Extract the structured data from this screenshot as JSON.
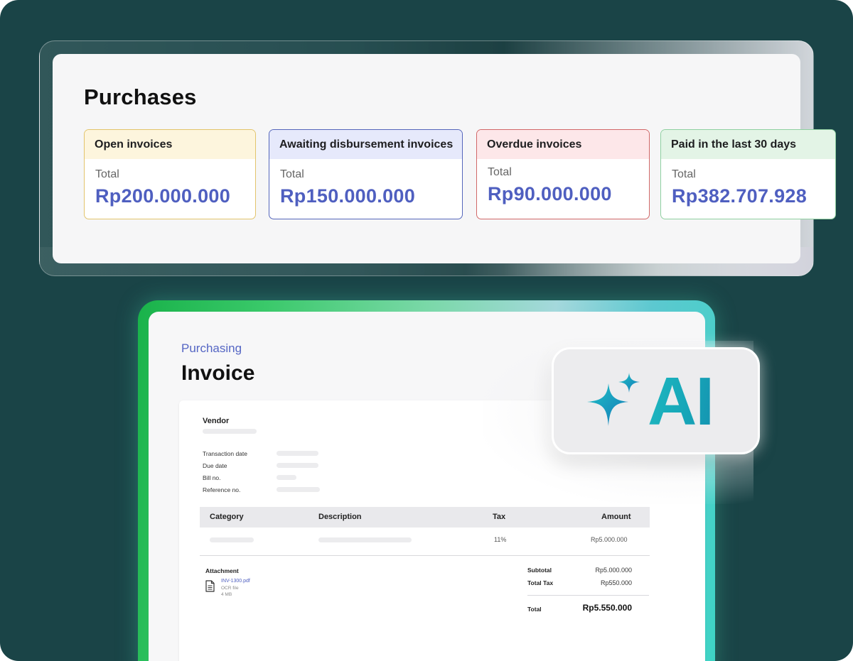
{
  "purchases": {
    "title": "Purchases",
    "cards": [
      {
        "title": "Open invoices",
        "label": "Total",
        "value": "Rp200.000.000",
        "color": "#e2c46c"
      },
      {
        "title": "Awaiting disbursement invoices",
        "label": "Total",
        "value": "Rp150.000.000",
        "color": "#5566bb"
      },
      {
        "title": "Overdue invoices",
        "label": "Total",
        "value": "Rp90.000.000",
        "color": "#d16868"
      },
      {
        "title": "Paid in the last 30 days",
        "label": "Total",
        "value": "Rp382.707.928",
        "color": "#8fd0a0"
      }
    ]
  },
  "invoice": {
    "breadcrumb": "Purchasing",
    "title": "Invoice",
    "vendor_label": "Vendor",
    "fields": [
      "Transaction date",
      "Due date",
      "Bill no.",
      "Reference no."
    ],
    "table": {
      "headers": [
        "Category",
        "Description",
        "Tax",
        "Amount"
      ],
      "row": {
        "tax": "11%",
        "amount": "Rp5.000.000"
      }
    },
    "attachment": {
      "label": "Attachment",
      "file_name": "INV-1300.pdf",
      "file_type": "OCR file",
      "file_size": "4 MB"
    },
    "summary": {
      "subtotal_label": "Subtotal",
      "subtotal": "Rp5.000.000",
      "tax_label": "Total Tax",
      "tax": "Rp550.000",
      "total_label": "Total",
      "total": "Rp5.550.000"
    }
  },
  "ai_badge": {
    "text": "AI",
    "icon": "sparkle-icon"
  }
}
